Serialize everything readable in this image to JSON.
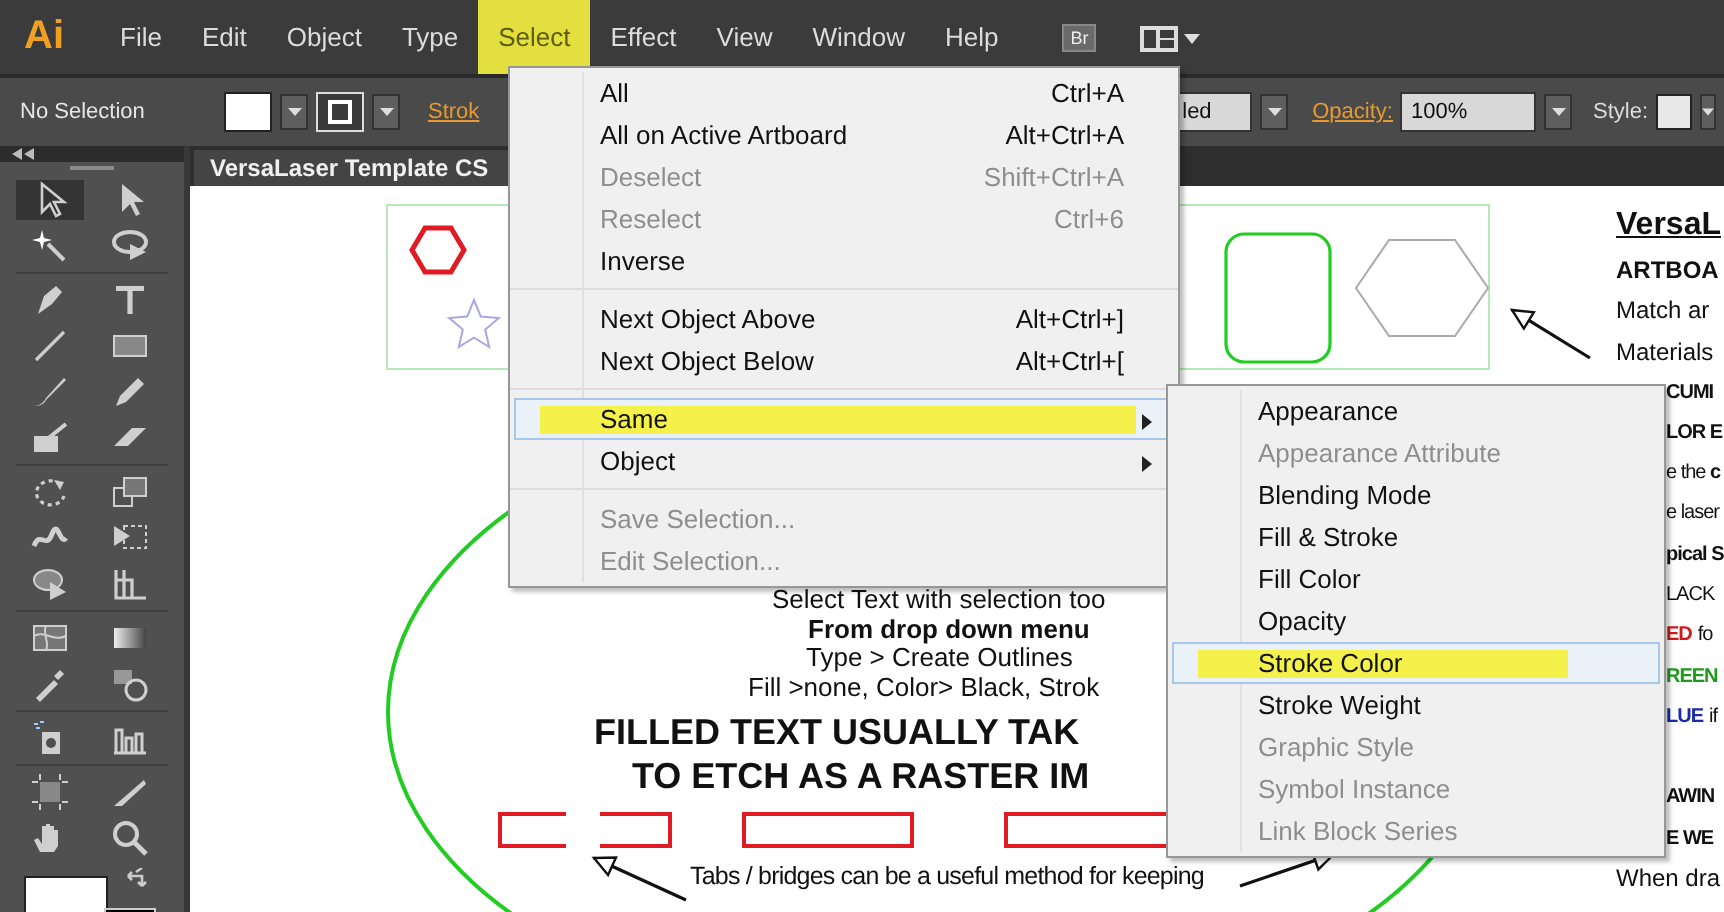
{
  "menubar": {
    "logo": "Ai",
    "items": [
      {
        "label": "File",
        "selected": false
      },
      {
        "label": "Edit",
        "selected": false
      },
      {
        "label": "Object",
        "selected": false
      },
      {
        "label": "Type",
        "selected": false
      },
      {
        "label": "Select",
        "selected": true
      },
      {
        "label": "Effect",
        "selected": false
      },
      {
        "label": "View",
        "selected": false
      },
      {
        "label": "Window",
        "selected": false
      },
      {
        "label": "Help",
        "selected": false
      }
    ],
    "bridge_button": "Br"
  },
  "control_bar": {
    "selection": "No Selection",
    "stroke_label": "Strok",
    "profile": "led",
    "opacity_label": "Opacity:",
    "opacity": "100%",
    "style_label": "Style:"
  },
  "document_tab": {
    "title": "VersaLaser Template CS"
  },
  "select_menu": {
    "groups": [
      [
        {
          "label": "All",
          "shortcut": "Ctrl+A",
          "disabled": false,
          "selected": false,
          "submenu": false
        },
        {
          "label": "All on Active Artboard",
          "shortcut": "Alt+Ctrl+A",
          "disabled": false,
          "selected": false,
          "submenu": false
        },
        {
          "label": "Deselect",
          "shortcut": "Shift+Ctrl+A",
          "disabled": true,
          "selected": false,
          "submenu": false
        },
        {
          "label": "Reselect",
          "shortcut": "Ctrl+6",
          "disabled": true,
          "selected": false,
          "submenu": false
        },
        {
          "label": "Inverse",
          "disabled": false,
          "selected": false,
          "submenu": false
        }
      ],
      [
        {
          "label": "Next Object Above",
          "shortcut": "Alt+Ctrl+]",
          "disabled": false,
          "selected": false,
          "submenu": false
        },
        {
          "label": "Next Object Below",
          "shortcut": "Alt+Ctrl+[",
          "disabled": false,
          "selected": false,
          "submenu": false
        }
      ],
      [
        {
          "label": "Same",
          "disabled": false,
          "selected": true,
          "submenu": true
        },
        {
          "label": "Object",
          "disabled": false,
          "selected": false,
          "submenu": true
        }
      ],
      [
        {
          "label": "Save Selection...",
          "disabled": true,
          "selected": false,
          "submenu": false
        },
        {
          "label": "Edit Selection...",
          "disabled": true,
          "selected": false,
          "submenu": false
        }
      ]
    ]
  },
  "same_submenu": {
    "items": [
      {
        "label": "Appearance",
        "disabled": false,
        "selected": false
      },
      {
        "label": "Appearance Attribute",
        "disabled": true,
        "selected": false
      },
      {
        "label": "Blending Mode",
        "disabled": false,
        "selected": false
      },
      {
        "label": "Fill & Stroke",
        "disabled": false,
        "selected": false
      },
      {
        "label": "Fill Color",
        "disabled": false,
        "selected": false
      },
      {
        "label": "Opacity",
        "disabled": false,
        "selected": false
      },
      {
        "label": "Stroke Color",
        "disabled": false,
        "selected": true
      },
      {
        "label": "Stroke Weight",
        "disabled": false,
        "selected": false
      },
      {
        "label": "Graphic Style",
        "disabled": true,
        "selected": false
      },
      {
        "label": "Symbol Instance",
        "disabled": true,
        "selected": false
      },
      {
        "label": "Link Block Series",
        "disabled": true,
        "selected": false
      }
    ]
  },
  "canvas": {
    "instructions": [
      {
        "text": "Select Text with selection too",
        "kind": "plain"
      },
      {
        "text": "From drop down menu",
        "kind": "bold"
      },
      {
        "text": "Type > Create Outlines",
        "kind": "plain"
      },
      {
        "text": "Fill >none, Color> Black, Strok",
        "kind": "plain"
      }
    ],
    "headline": [
      "FILLED TEXT USUALLY TAK",
      "TO ETCH AS A RASTER IM"
    ],
    "note": "Tabs / bridges can be a useful method for keeping",
    "side_notes": [
      [
        {
          "kind": "heading",
          "clipped": false,
          "parts": [
            {
              "text": "VersaL"
            }
          ]
        },
        {
          "kind": "bold",
          "clipped": false,
          "parts": [
            {
              "text": "ARTBOA"
            }
          ]
        },
        {
          "kind": "plain",
          "clipped": false,
          "parts": [
            {
              "text": "Match ar"
            }
          ]
        },
        {
          "kind": "plain",
          "clipped": false,
          "parts": [
            {
              "text": "Materials"
            }
          ]
        },
        {
          "kind": "bold",
          "clipped": true,
          "parts": [
            {
              "text": "CUMI"
            }
          ]
        },
        {
          "kind": "bold",
          "clipped": true,
          "parts": [
            {
              "text": "LOR E"
            }
          ]
        },
        {
          "kind": "plain",
          "clipped": true,
          "parts": [
            {
              "text": "e the **c**"
            }
          ]
        },
        {
          "kind": "plain",
          "clipped": true,
          "parts": [
            {
              "text": "e laser"
            }
          ]
        },
        {
          "kind": "bold",
          "clipped": true,
          "parts": [
            {
              "text": "pical S"
            }
          ]
        },
        {
          "kind": "plain",
          "clipped": true,
          "parts": [
            {
              "text": "LACK"
            }
          ]
        },
        {
          "kind": "plain",
          "clipped": true,
          "parts": [
            {
              "text": "ED",
              "color": "#d21a1a"
            },
            {
              "text": "fo"
            }
          ]
        },
        {
          "kind": "plain",
          "clipped": true,
          "parts": [
            {
              "text": "REEN",
              "color": "#1f9a1f"
            }
          ]
        },
        {
          "kind": "plain",
          "clipped": true,
          "parts": [
            {
              "text": "LUE",
              "color": "#1a2aa8"
            },
            {
              "text": "if"
            }
          ]
        }
      ],
      [
        {
          "kind": "bold",
          "clipped": true,
          "parts": [
            {
              "text": "AWIN"
            }
          ]
        },
        {
          "kind": "bold",
          "clipped": true,
          "parts": [
            {
              "text": "E WE"
            }
          ]
        },
        {
          "kind": "plain",
          "clipped": false,
          "parts": [
            {
              "text": "When dra"
            }
          ]
        }
      ]
    ]
  }
}
